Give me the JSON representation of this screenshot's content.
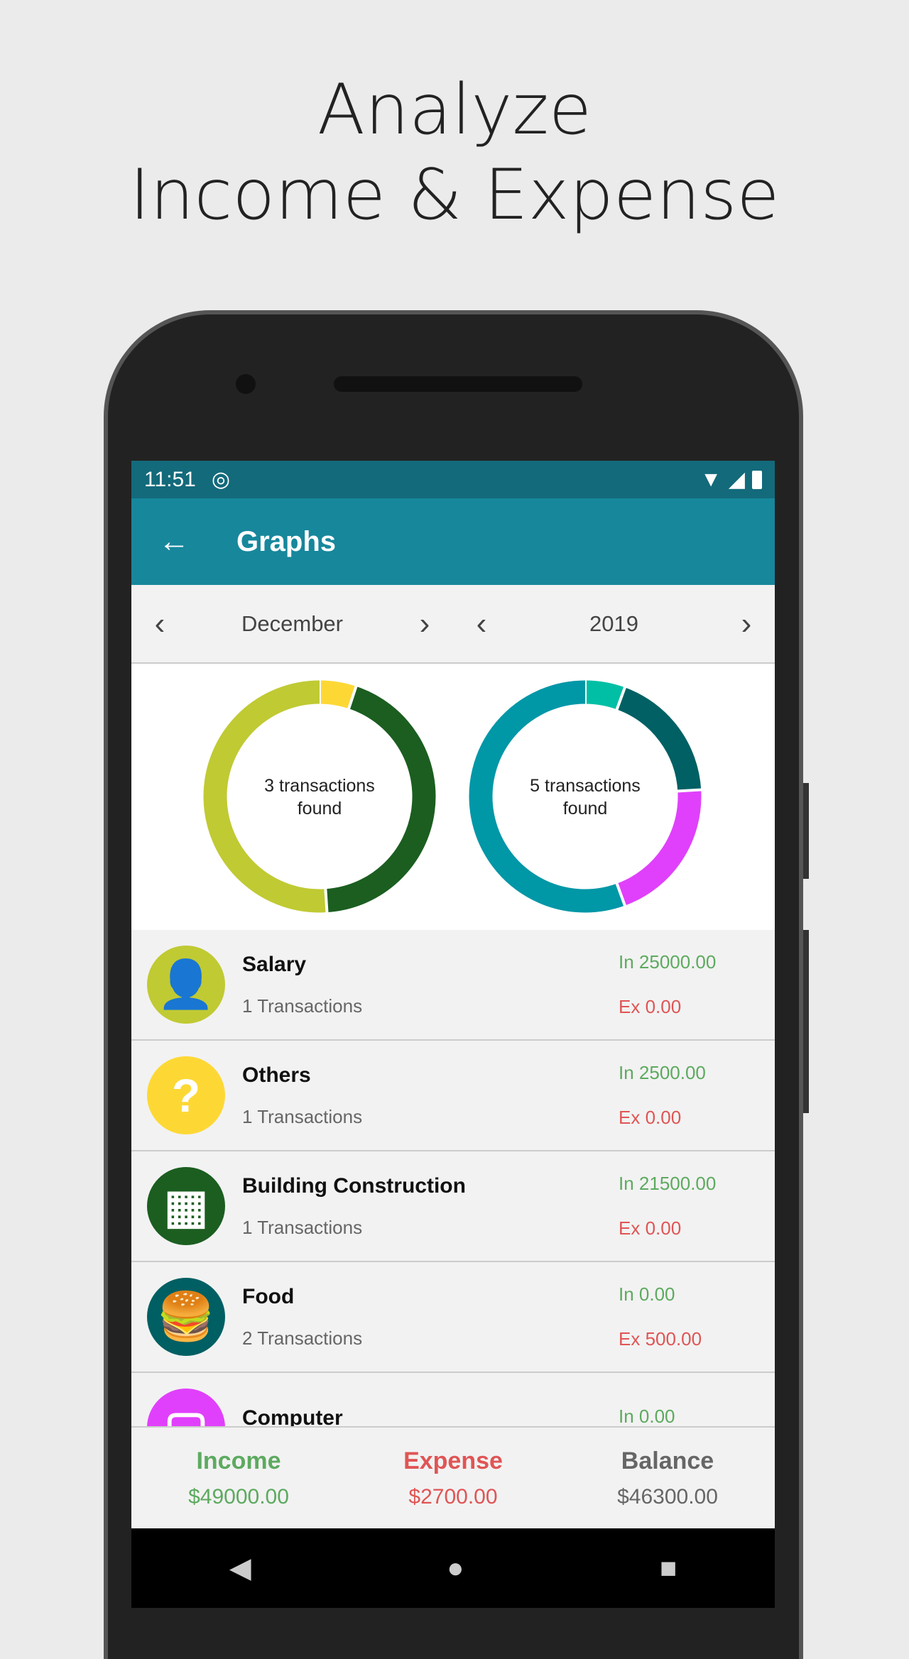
{
  "headline": [
    "Analyze",
    "Income & Expense"
  ],
  "status": {
    "time": "11:51"
  },
  "toolbar": {
    "title": "Graphs"
  },
  "period": {
    "month": "December",
    "year": "2019"
  },
  "chart_data": [
    {
      "type": "pie",
      "center_label": "3 transactions found",
      "slices": [
        {
          "name": "Others",
          "value": 2500,
          "color": "#fdd835"
        },
        {
          "name": "Building Construction",
          "value": 21500,
          "color": "#1b5e20"
        },
        {
          "name": "Salary",
          "value": 25000,
          "color": "#c0ca33"
        }
      ]
    },
    {
      "type": "pie",
      "center_label": "5 transactions found",
      "slices": [
        {
          "value": 150,
          "color": "#00bfa5"
        },
        {
          "name": "Food",
          "value": 500,
          "color": "#006064"
        },
        {
          "name": "Computer",
          "value": 550,
          "color": "#e040fb"
        },
        {
          "value": 1500,
          "color": "#0097a7"
        }
      ]
    }
  ],
  "categories": [
    {
      "name": "Salary",
      "count": "1 Transactions",
      "in": "In 25000.00",
      "ex": "Ex 0.00",
      "color": "#c0ca33",
      "icon": "person-icon"
    },
    {
      "name": "Others",
      "count": "1 Transactions",
      "in": "In 2500.00",
      "ex": "Ex 0.00",
      "color": "#fdd835",
      "icon": "question-icon"
    },
    {
      "name": "Building Construction",
      "count": "1 Transactions",
      "in": "In 21500.00",
      "ex": "Ex 0.00",
      "color": "#1b5e20",
      "icon": "building-icon"
    },
    {
      "name": "Food",
      "count": "2 Transactions",
      "in": "In 0.00",
      "ex": "Ex 500.00",
      "color": "#005f63",
      "icon": "food-icon"
    },
    {
      "name": "Computer",
      "count": "",
      "in": "In 0.00",
      "ex": "",
      "color": "#e040fb",
      "icon": "computer-icon"
    }
  ],
  "summary": {
    "income_label": "Income",
    "income": "$49000.00",
    "expense_label": "Expense",
    "expense": "$2700.00",
    "balance_label": "Balance",
    "balance": "$46300.00"
  },
  "colors": {
    "income": "#5daa5f",
    "expense": "#e05555",
    "toolbar": "#17879c",
    "status": "#136a7b"
  }
}
